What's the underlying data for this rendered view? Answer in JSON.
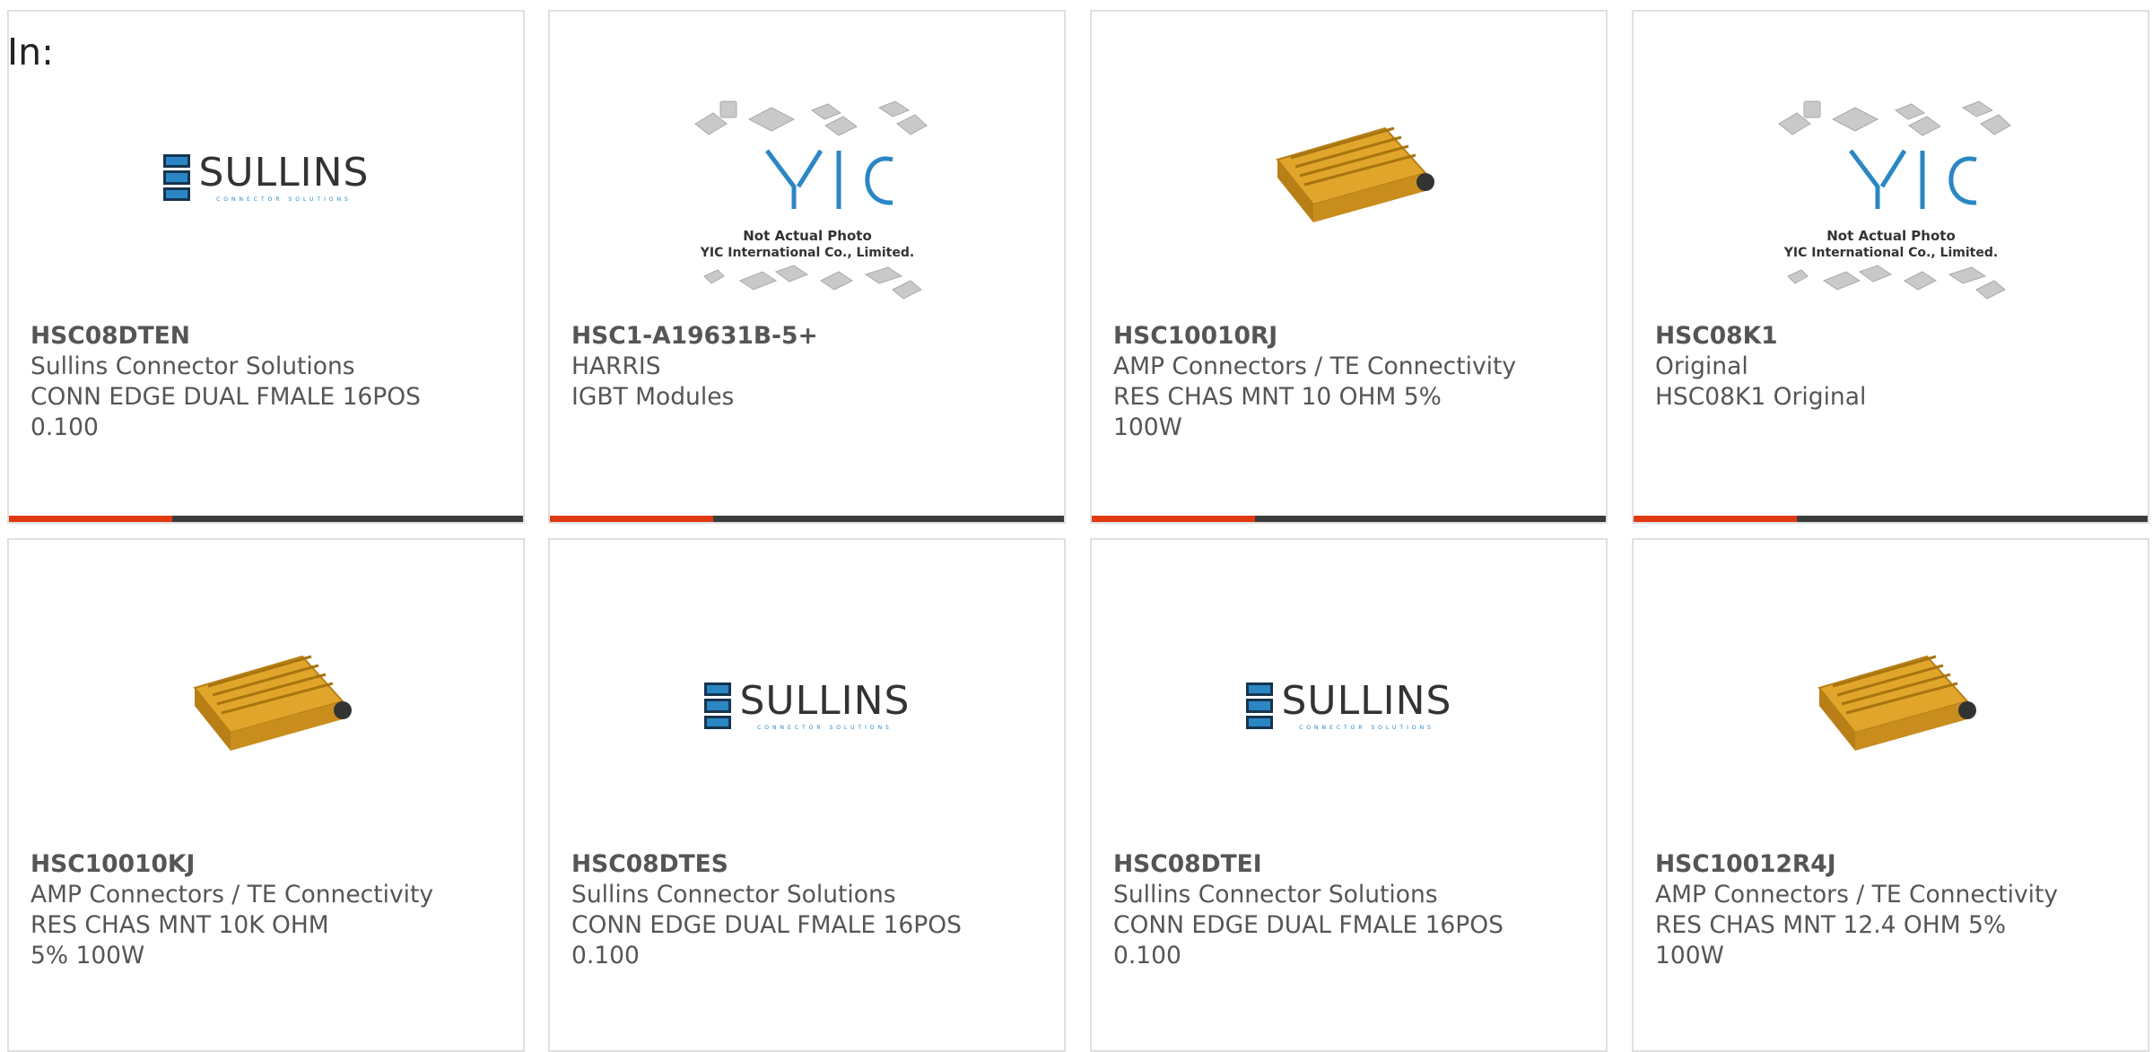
{
  "header": {
    "label": "In:"
  },
  "colors": {
    "accent": "#e03a12",
    "bar": "#3c3c3c",
    "border": "#e0e0e0",
    "text": "#555555"
  },
  "products": [
    {
      "part_number": "HSC08DTEN",
      "manufacturer": "Sullins Connector Solutions",
      "description": "CONN EDGE DUAL FMALE 16POS 0.100",
      "image": "sullins-logo"
    },
    {
      "part_number": "HSC1-A19631B-5+",
      "manufacturer": "HARRIS",
      "description": "IGBT Modules",
      "image": "yic-placeholder"
    },
    {
      "part_number": "HSC10010RJ",
      "manufacturer": "AMP Connectors / TE Connectivity",
      "description": "RES CHAS MNT 10 OHM 5% 100W",
      "image": "resistor-photo"
    },
    {
      "part_number": "HSC08K1",
      "manufacturer": "Original",
      "description": "HSC08K1 Original",
      "image": "yic-placeholder"
    },
    {
      "part_number": "HSC10010KJ",
      "manufacturer": "AMP Connectors / TE Connectivity",
      "description": "RES CHAS MNT 10K OHM 5% 100W",
      "image": "resistor-photo"
    },
    {
      "part_number": "HSC08DTES",
      "manufacturer": "Sullins Connector Solutions",
      "description": "CONN EDGE DUAL FMALE 16POS 0.100",
      "image": "sullins-logo"
    },
    {
      "part_number": "HSC08DTEI",
      "manufacturer": "Sullins Connector Solutions",
      "description": "CONN EDGE DUAL FMALE 16POS 0.100",
      "image": "sullins-logo"
    },
    {
      "part_number": "HSC10012R4J",
      "manufacturer": "AMP Connectors / TE Connectivity",
      "description": "RES CHAS MNT 12.4 OHM 5% 100W",
      "image": "resistor-photo"
    }
  ],
  "images": {
    "sullins-logo": {
      "name": "SULLINS",
      "tagline": "CONNECTOR SOLUTIONS"
    },
    "yic-placeholder": {
      "line1": "Not Actual Photo",
      "line2": "YIC International Co., Limited."
    }
  }
}
